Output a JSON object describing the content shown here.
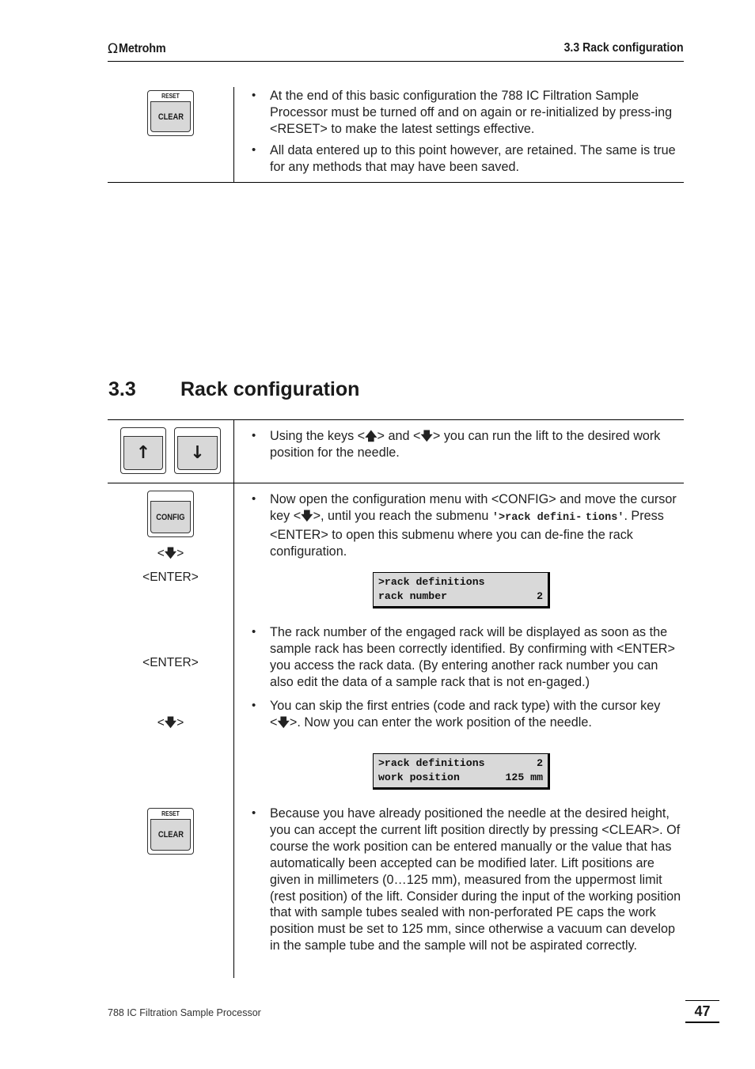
{
  "header": {
    "logo_symbol": "Ω",
    "logo_text": "Metrohm",
    "section_title": "3.3  Rack configuration"
  },
  "top_block": {
    "key": {
      "top_label": "RESET",
      "main_label": "CLEAR"
    },
    "bullets": [
      "At the end of this basic configuration the 788 IC Filtration Sample Processor must be turned off and on again or re-initialized by press-ing <RESET> to make the latest settings effective.",
      "All data entered up to this point however, are retained. The same is true for any methods that may have been saved."
    ]
  },
  "section": {
    "number": "3.3",
    "title": "Rack configuration"
  },
  "row1": {
    "keys": [
      {
        "name": "up",
        "glyph": "↑"
      },
      {
        "name": "down",
        "glyph": "↓"
      }
    ],
    "bullet": {
      "before_up": "Using the keys <",
      "up_glyph": "🡅",
      "mid": "> and <",
      "down_glyph": "🡇",
      "after": "> you can run the lift to the desired work position for the needle."
    }
  },
  "row2": {
    "key": {
      "main_label": "CONFIG"
    },
    "side_labels": {
      "down_prefix": "<",
      "down_glyph": "🡇",
      "down_suffix": ">",
      "enter": "<ENTER>"
    },
    "bullet": {
      "part1": "Now open the configuration menu with <CONFIG> and move the cursor key <",
      "down_glyph": "🡇",
      "part2": ">, until you reach the submenu ",
      "mono1": "'>rack defini-",
      "mono2": "tions'",
      "part3": ". Press <ENTER> to open this submenu where you can de-fine the rack configuration."
    },
    "lcd": {
      "line1_left": ">rack definitions",
      "line1_right": "",
      "line2_left": "rack number",
      "line2_right": "2"
    }
  },
  "row3": {
    "side_labels": {
      "enter": "<ENTER>",
      "down_prefix": "<",
      "down_glyph": "🡇",
      "down_suffix": ">"
    },
    "bullet1": "The rack number of the engaged rack will be displayed as soon as the sample rack has been correctly identified. By confirming with <ENTER> you access the rack data. (By entering another rack number you can also edit the data of a sample rack that is not en-gaged.)",
    "bullet2": {
      "part1": "You can skip the first entries (code and rack type) with the cursor key <",
      "down_glyph": "🡇",
      "part2": ">. Now you can enter the work position of the needle."
    },
    "lcd": {
      "line1_left": ">rack definitions",
      "line1_right": "2",
      "line2_left": "work position",
      "line2_right": "125 mm"
    }
  },
  "row4": {
    "key": {
      "top_label": "RESET",
      "main_label": "CLEAR"
    },
    "bullet": "Because you have already positioned the needle at the desired height, you can accept the current lift position directly by pressing <CLEAR>. Of course the work position can be entered manually or the value that has automatically been accepted can be modified later. Lift positions are given in millimeters (0…125 mm), measured from the uppermost limit (rest position) of the lift. Consider during the input of the working position that with sample tubes sealed with non-perforated PE caps the work position must be set to 125 mm, since otherwise a vacuum can develop in the sample tube and the sample will not be aspirated correctly."
  },
  "footer": {
    "product": "788 IC Filtration Sample Processor",
    "page_number": "47"
  }
}
